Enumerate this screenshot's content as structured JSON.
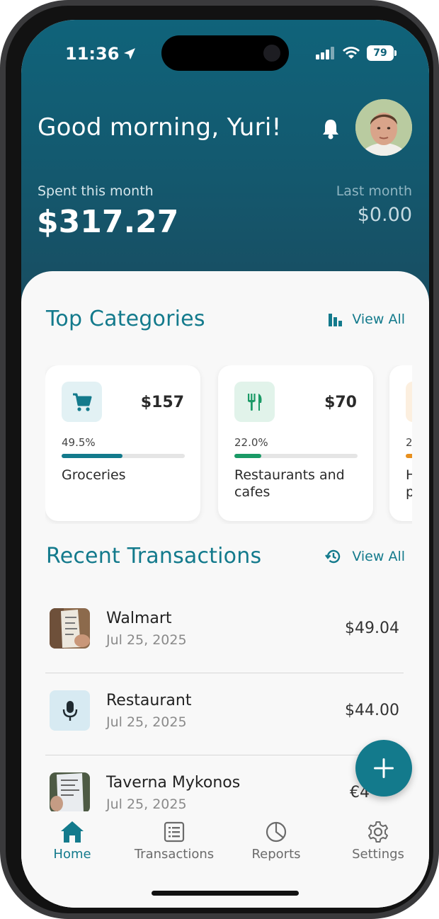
{
  "status_bar": {
    "time": "11:36",
    "battery": "79"
  },
  "header": {
    "greeting": "Good morning, Yuri!",
    "spent_label": "Spent this month",
    "spent_amount": "$317.27",
    "last_label": "Last month",
    "last_amount": "$0.00"
  },
  "top_categories": {
    "title": "Top Categories",
    "view_all": "View All",
    "items": [
      {
        "name": "Groceries",
        "amount": "$157",
        "percent_label": "49.5%",
        "percent": 49.5,
        "icon": "cart-icon",
        "color": "#137a8c",
        "icon_bg": "#e2f1f4"
      },
      {
        "name": "Restaurants and cafes",
        "amount": "$70",
        "percent_label": "22.0%",
        "percent": 22.0,
        "icon": "utensils-icon",
        "color": "#1a9a66",
        "icon_bg": "#e1f3ea"
      },
      {
        "name": "H p",
        "amount": "",
        "percent_label": "2",
        "percent": 20,
        "icon": "category-icon",
        "color": "#e8901e",
        "icon_bg": "#fcefdf"
      }
    ]
  },
  "recent_transactions": {
    "title": "Recent Transactions",
    "view_all": "View All",
    "items": [
      {
        "merchant": "Walmart",
        "date": "Jul 25, 2025",
        "amount": "$49.04",
        "thumb": "receipt-photo"
      },
      {
        "merchant": "Restaurant",
        "date": "Jul 25, 2025",
        "amount": "$44.00",
        "thumb": "microphone-icon"
      },
      {
        "merchant": "Taverna Mykonos",
        "date": "Jul 25, 2025",
        "amount": "€4",
        "thumb": "receipt-photo"
      }
    ]
  },
  "tabs": [
    {
      "label": "Home",
      "icon": "home-icon",
      "active": true
    },
    {
      "label": "Transactions",
      "icon": "list-icon",
      "active": false
    },
    {
      "label": "Reports",
      "icon": "pie-chart-icon",
      "active": false
    },
    {
      "label": "Settings",
      "icon": "gear-icon",
      "active": false
    }
  ],
  "colors": {
    "accent": "#137a8c",
    "header_top": "#10637a",
    "header_bottom": "#194c60"
  }
}
